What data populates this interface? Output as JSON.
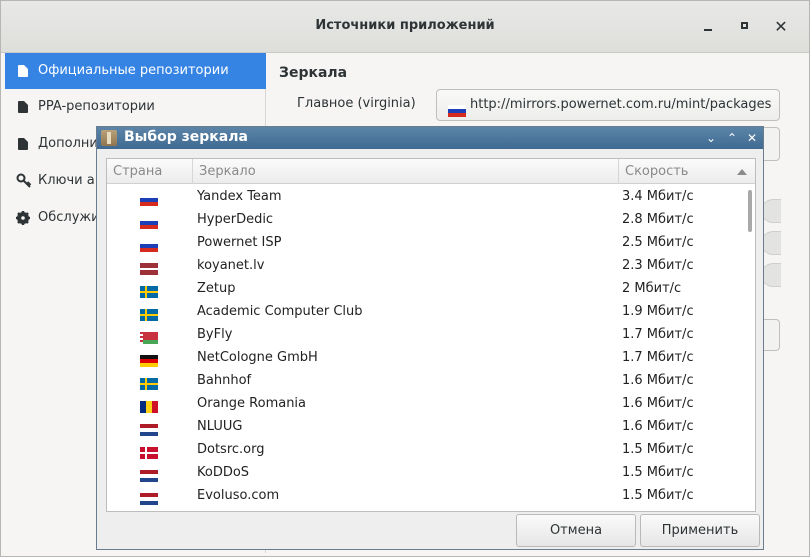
{
  "window": {
    "title": "Источники приложений",
    "controls": [
      "minimize",
      "maximize",
      "close"
    ]
  },
  "sidebar": {
    "items": [
      {
        "label": "Официальные репозитории",
        "icon": "file-icon",
        "active": true
      },
      {
        "label": "PPA-репозитории",
        "icon": "file-icon",
        "active": false
      },
      {
        "label": "Дополни",
        "icon": "file-icon",
        "active": false
      },
      {
        "label": "Ключи а",
        "icon": "key-icon",
        "active": false
      },
      {
        "label": "Обслужи",
        "icon": "gear-icon",
        "active": false
      }
    ]
  },
  "content": {
    "section_title": "Зеркала",
    "main_label": "Главное (virginia)",
    "main_mirror": {
      "flag": "ru",
      "url": "http://mirrors.powernet.com.ru/mint/packages"
    }
  },
  "dialog": {
    "title": "Выбор зеркала",
    "columns": {
      "country": "Страна",
      "mirror": "Зеркало",
      "speed": "Скорость"
    },
    "sort": "speed-descending",
    "rows": [
      {
        "flag": "ru",
        "name": "Yandex Team",
        "speed": "3.4 Мбит/с"
      },
      {
        "flag": "ru",
        "name": "HyperDedic",
        "speed": "2.8 Мбит/с"
      },
      {
        "flag": "ru",
        "name": "Powernet ISP",
        "speed": "2.5 Мбит/с"
      },
      {
        "flag": "lv",
        "name": "koyanet.lv",
        "speed": "2.3 Мбит/с"
      },
      {
        "flag": "se",
        "name": "Zetup",
        "speed": "2 Мбит/с"
      },
      {
        "flag": "se",
        "name": "Academic Computer Club",
        "speed": "1.9 Мбит/с"
      },
      {
        "flag": "by",
        "name": "ByFly",
        "speed": "1.7 Мбит/с"
      },
      {
        "flag": "de",
        "name": "NetCologne GmbH",
        "speed": "1.7 Мбит/с"
      },
      {
        "flag": "se",
        "name": "Bahnhof",
        "speed": "1.6 Мбит/с"
      },
      {
        "flag": "ro",
        "name": "Orange Romania",
        "speed": "1.6 Мбит/с"
      },
      {
        "flag": "nl",
        "name": "NLUUG",
        "speed": "1.6 Мбит/с"
      },
      {
        "flag": "dk",
        "name": "Dotsrc.org",
        "speed": "1.5 Мбит/с"
      },
      {
        "flag": "nl",
        "name": "KoDDoS",
        "speed": "1.5 Мбит/с"
      },
      {
        "flag": "nl",
        "name": "Evoluso.com",
        "speed": "1.5 Мбит/с"
      }
    ],
    "buttons": {
      "cancel": "Отмена",
      "apply": "Применить"
    }
  },
  "colors": {
    "accent": "#3584e4",
    "dialog_titlebar": "#4b7399"
  }
}
